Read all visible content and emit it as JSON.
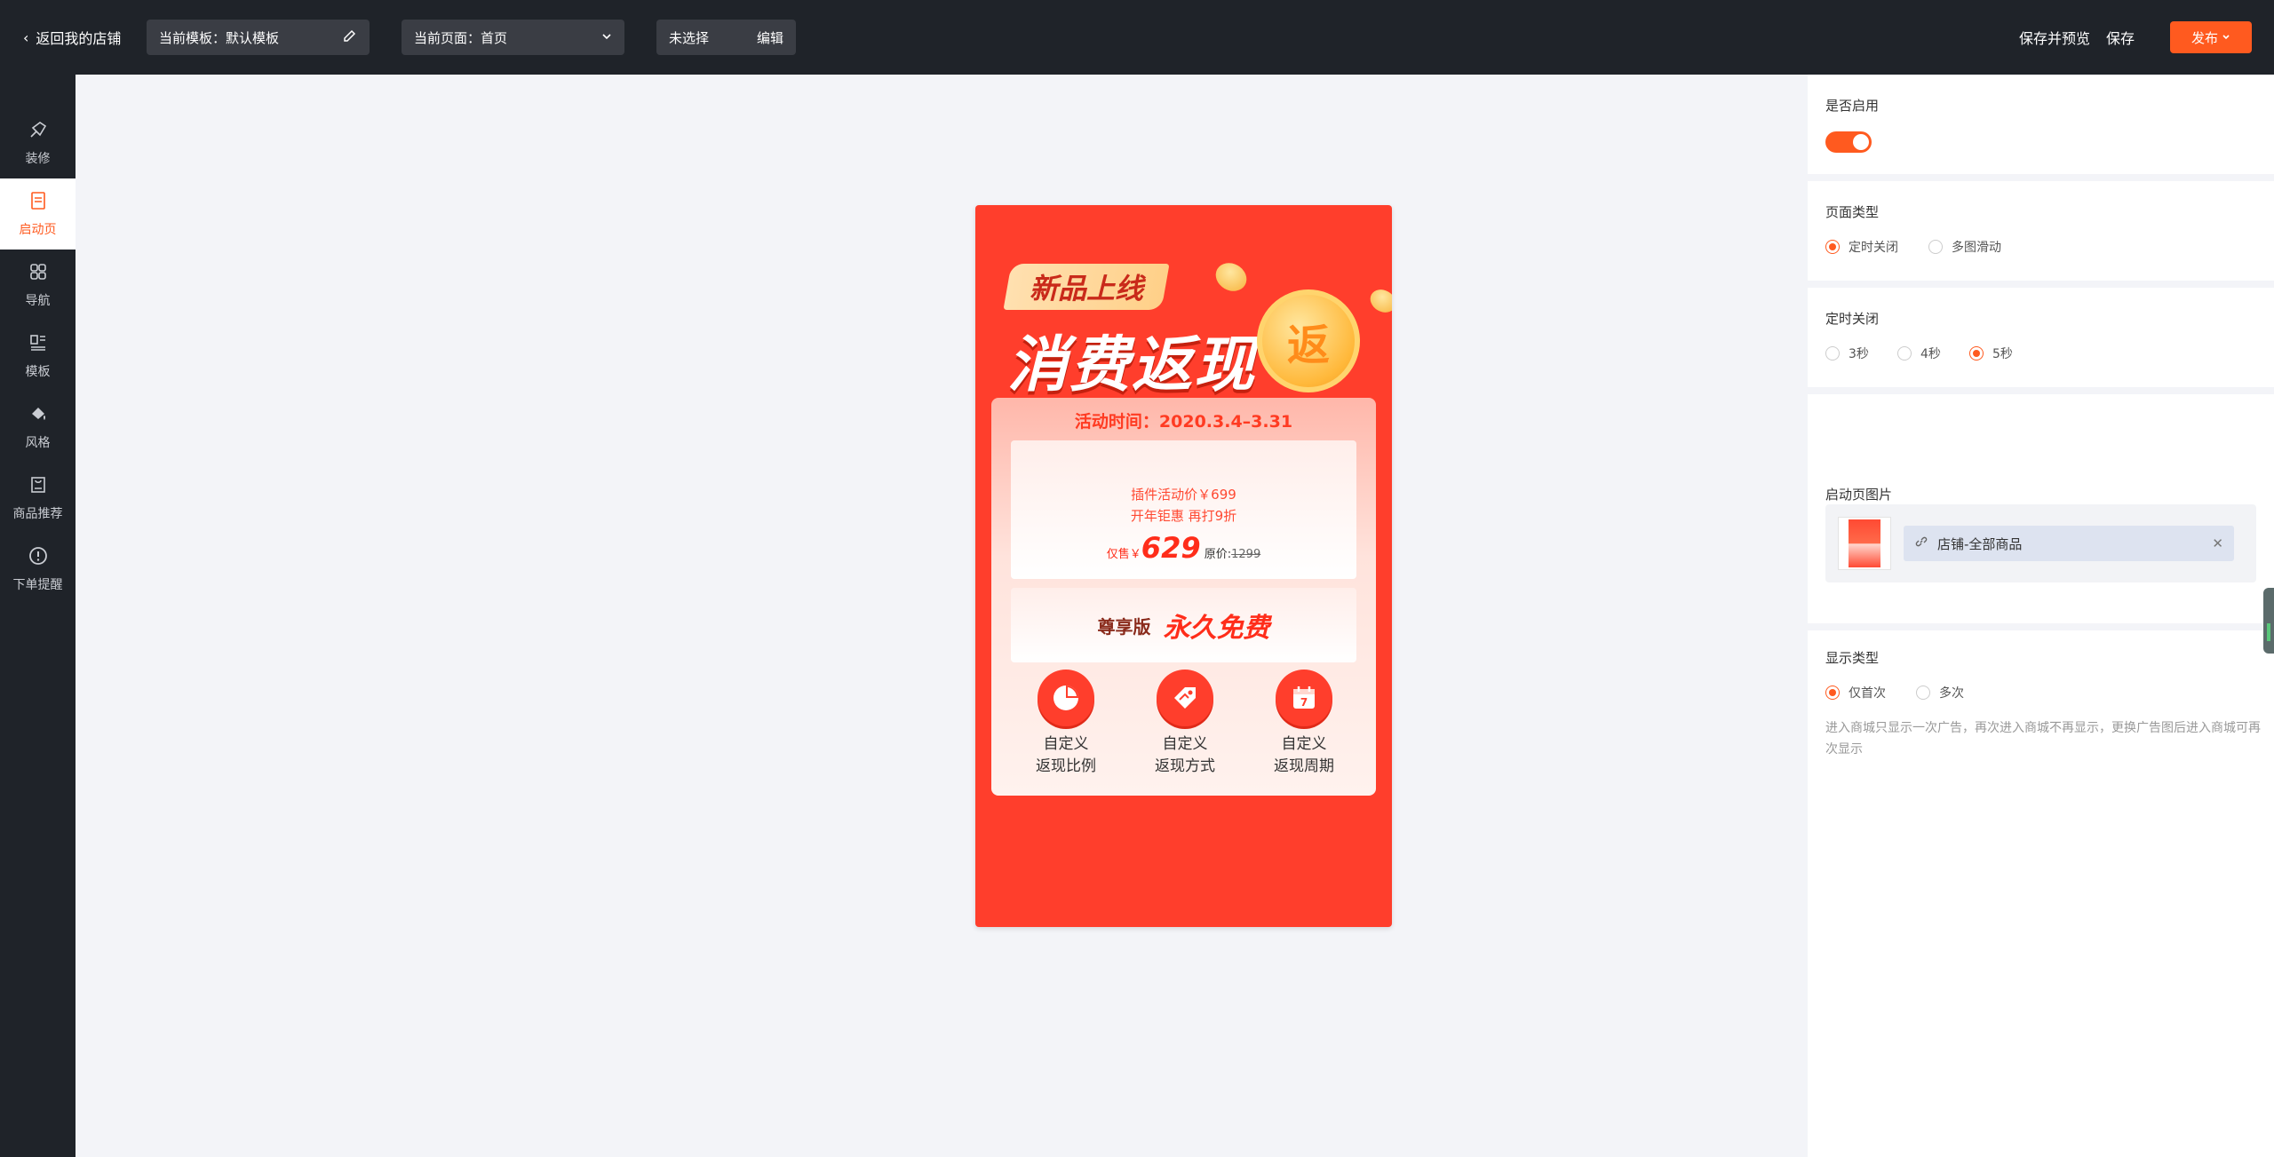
{
  "header": {
    "back_label": "返回我的店铺",
    "template_label": "当前模板：默认模板",
    "page_label": "当前页面：首页",
    "selection_label": "未选择",
    "edit_label": "编辑",
    "save_preview": "保存并预览",
    "save": "保存",
    "publish": "发布"
  },
  "sidebar": {
    "items": [
      {
        "label": "装修",
        "icon": "brush-icon"
      },
      {
        "label": "启动页",
        "icon": "document-icon"
      },
      {
        "label": "导航",
        "icon": "grid-icon"
      },
      {
        "label": "模板",
        "icon": "template-icon"
      },
      {
        "label": "风格",
        "icon": "paint-bucket-icon"
      },
      {
        "label": "商品推荐",
        "icon": "bag-icon"
      },
      {
        "label": "下单提醒",
        "icon": "alert-icon"
      }
    ],
    "active_index": 1
  },
  "preview": {
    "tag": "新品上线",
    "title": "消费返现",
    "coin": "返",
    "time": "活动时间：2020.3.4–3.31",
    "price_line1": "插件活动价￥699",
    "price_line2": "开年钜惠 再打9折",
    "only_prefix": "仅售￥",
    "only_price": "629",
    "original_label": "原价:",
    "original_price": "1299",
    "vip_label": "尊享版",
    "vip_free": "永久免费",
    "features": [
      {
        "line1": "自定义",
        "line2": "返现比例",
        "icon": "pie-chart-icon"
      },
      {
        "line1": "自定义",
        "line2": "返现方式",
        "icon": "tag-icon"
      },
      {
        "line1": "自定义",
        "line2": "返现周期",
        "icon": "calendar-icon"
      }
    ],
    "calendar_day": "7"
  },
  "panel": {
    "enable_title": "是否启用",
    "enabled": true,
    "page_type_title": "页面类型",
    "page_type_options": [
      "定时关闭",
      "多图滑动"
    ],
    "page_type_selected": "定时关闭",
    "timer_title": "定时关闭",
    "timer_options": [
      "3秒",
      "4秒",
      "5秒"
    ],
    "timer_selected": "5秒",
    "image_title": "启动页图片",
    "image_link": "店铺-全部商品",
    "display_title": "显示类型",
    "display_options": [
      "仅首次",
      "多次"
    ],
    "display_selected": "仅首次",
    "display_desc": "进入商城只显示一次广告，再次进入商城不再显示，更换广告图后进入商城可再次显示"
  },
  "colors": {
    "accent": "#ff5a1f",
    "dark": "#1f2329",
    "promo_red": "#ff3e2c"
  }
}
